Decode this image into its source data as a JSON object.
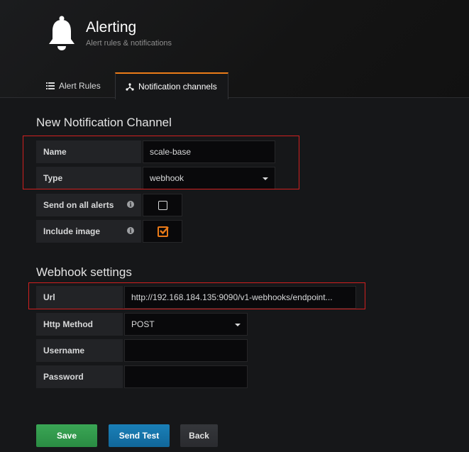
{
  "header": {
    "title": "Alerting",
    "subtitle": "Alert rules & notifications",
    "icon": "bell-icon"
  },
  "tabs": [
    {
      "label": "Alert Rules",
      "icon": "list-icon",
      "active": false
    },
    {
      "label": "Notification channels",
      "icon": "share-icon",
      "active": true
    }
  ],
  "channel": {
    "section_title": "New Notification Channel",
    "name_label": "Name",
    "name_value": "scale-base",
    "type_label": "Type",
    "type_value": "webhook",
    "send_all_label": "Send on all alerts",
    "send_all_checked": false,
    "include_image_label": "Include image",
    "include_image_checked": true
  },
  "webhook": {
    "section_title": "Webhook settings",
    "url_label": "Url",
    "url_value": "http://192.168.184.135:9090/v1-webhooks/endpoint...",
    "method_label": "Http Method",
    "method_value": "POST",
    "username_label": "Username",
    "username_value": "",
    "password_label": "Password",
    "password_value": ""
  },
  "actions": {
    "save_label": "Save",
    "test_label": "Send Test",
    "back_label": "Back"
  },
  "colors": {
    "accent_orange": "#eb7b18",
    "save_green": "#2a8c43",
    "test_blue": "#11679a",
    "highlight_red": "#d02020"
  }
}
